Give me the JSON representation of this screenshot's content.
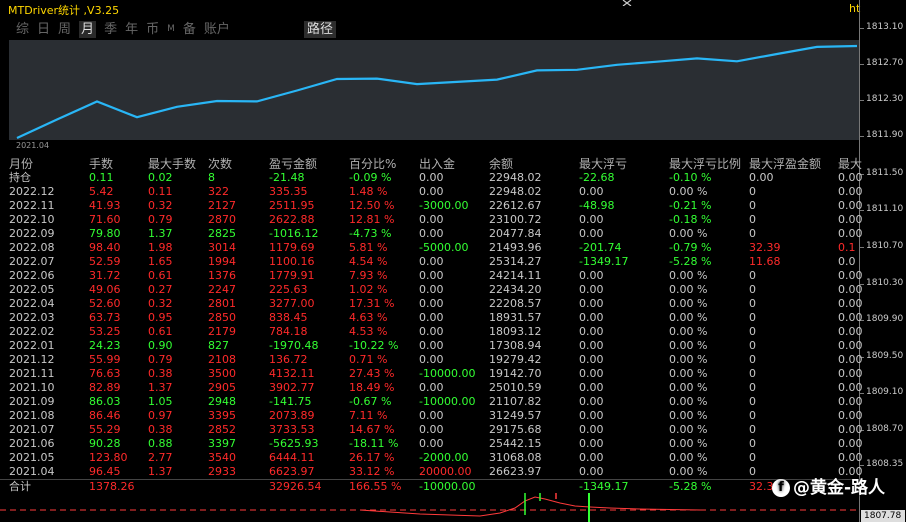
{
  "header": {
    "title": "MTDriver统计 ,V3.25",
    "title_right": "ht"
  },
  "tabs": [
    {
      "label": "综",
      "active": false
    },
    {
      "label": "日",
      "active": false
    },
    {
      "label": "周",
      "active": false
    },
    {
      "label": "月",
      "active": true
    },
    {
      "label": "季",
      "active": false
    },
    {
      "label": "年",
      "active": false
    },
    {
      "label": "币",
      "active": false
    },
    {
      "label": "M",
      "active": false
    },
    {
      "label": "备",
      "active": false
    },
    {
      "label": "账户",
      "active": false
    }
  ],
  "route_tab": "路径",
  "chart": {
    "date_label": "2021.04"
  },
  "yaxis": [
    "1813.10",
    "1812.70",
    "1812.30",
    "1811.90",
    "1811.50",
    "1811.10",
    "1810.70",
    "1810.30",
    "1809.90",
    "1809.50",
    "1809.10",
    "1808.70",
    "1808.35",
    "1807.78"
  ],
  "columns": [
    "月份",
    "手数",
    "最大手数",
    "次数",
    "盈亏金额",
    "百分比%",
    "出入金",
    "余额",
    "最大浮亏",
    "最大浮亏比例",
    "最大浮盈金额",
    "最大"
  ],
  "holding": {
    "label": "持仓",
    "lots": "0.11",
    "max_lots": "0.02",
    "count": "8",
    "pnl": "-21.48",
    "pct": "-0.09 %",
    "io": "0.00",
    "balance": "22948.02",
    "float_loss": "-22.68",
    "float_loss_pct": "-0.10 %",
    "float_profit": "0.00",
    "last": "0.00"
  },
  "rows": [
    {
      "month": "2022.12",
      "lots": "5.42",
      "max_lots": "0.11",
      "count": "322",
      "pnl": "335.35",
      "pct": "1.48 %",
      "io": "0.00",
      "balance": "22948.02",
      "float_loss": "0.00",
      "float_loss_pct": "0.00 %",
      "float_profit": "0",
      "last": "0.00",
      "color": "red"
    },
    {
      "month": "2022.11",
      "lots": "41.93",
      "max_lots": "0.32",
      "count": "2127",
      "pnl": "2511.95",
      "pct": "12.50 %",
      "io": "-3000.00",
      "balance": "22612.67",
      "float_loss": "-48.98",
      "float_loss_pct": "-0.21 %",
      "float_profit": "0",
      "last": "0.00",
      "color": "red"
    },
    {
      "month": "2022.10",
      "lots": "71.60",
      "max_lots": "0.79",
      "count": "2870",
      "pnl": "2622.88",
      "pct": "12.81 %",
      "io": "0.00",
      "balance": "23100.72",
      "float_loss": "0.00",
      "float_loss_pct": "-0.18 %",
      "float_profit": "0",
      "last": "0.00",
      "color": "red"
    },
    {
      "month": "2022.09",
      "lots": "79.80",
      "max_lots": "1.37",
      "count": "2825",
      "pnl": "-1016.12",
      "pct": "-4.73 %",
      "io": "0.00",
      "balance": "20477.84",
      "float_loss": "0.00",
      "float_loss_pct": "0.00 %",
      "float_profit": "0",
      "last": "0.00",
      "color": "green"
    },
    {
      "month": "2022.08",
      "lots": "98.40",
      "max_lots": "1.98",
      "count": "3014",
      "pnl": "1179.69",
      "pct": "5.81 %",
      "io": "-5000.00",
      "balance": "21493.96",
      "float_loss": "-201.74",
      "float_loss_pct": "-0.79 %",
      "float_profit": "32.39",
      "last": "0.1",
      "color": "red"
    },
    {
      "month": "2022.07",
      "lots": "52.59",
      "max_lots": "1.65",
      "count": "1994",
      "pnl": "1100.16",
      "pct": "4.54 %",
      "io": "0.00",
      "balance": "25314.27",
      "float_loss": "-1349.17",
      "float_loss_pct": "-5.28 %",
      "float_profit": "11.68",
      "last": "0.0",
      "color": "red"
    },
    {
      "month": "2022.06",
      "lots": "31.72",
      "max_lots": "0.61",
      "count": "1376",
      "pnl": "1779.91",
      "pct": "7.93 %",
      "io": "0.00",
      "balance": "24214.11",
      "float_loss": "0.00",
      "float_loss_pct": "0.00 %",
      "float_profit": "0",
      "last": "0.00",
      "color": "red"
    },
    {
      "month": "2022.05",
      "lots": "49.06",
      "max_lots": "0.27",
      "count": "2247",
      "pnl": "225.63",
      "pct": "1.02 %",
      "io": "0.00",
      "balance": "22434.20",
      "float_loss": "0.00",
      "float_loss_pct": "0.00 %",
      "float_profit": "0",
      "last": "0.00",
      "color": "red"
    },
    {
      "month": "2022.04",
      "lots": "52.60",
      "max_lots": "0.32",
      "count": "2801",
      "pnl": "3277.00",
      "pct": "17.31 %",
      "io": "0.00",
      "balance": "22208.57",
      "float_loss": "0.00",
      "float_loss_pct": "0.00 %",
      "float_profit": "0",
      "last": "0.00",
      "color": "red"
    },
    {
      "month": "2022.03",
      "lots": "63.73",
      "max_lots": "0.95",
      "count": "2850",
      "pnl": "838.45",
      "pct": "4.63 %",
      "io": "0.00",
      "balance": "18931.57",
      "float_loss": "0.00",
      "float_loss_pct": "0.00 %",
      "float_profit": "0",
      "last": "0.00",
      "color": "red"
    },
    {
      "month": "2022.02",
      "lots": "53.25",
      "max_lots": "0.61",
      "count": "2179",
      "pnl": "784.18",
      "pct": "4.53 %",
      "io": "0.00",
      "balance": "18093.12",
      "float_loss": "0.00",
      "float_loss_pct": "0.00 %",
      "float_profit": "0",
      "last": "0.00",
      "color": "red"
    },
    {
      "month": "2022.01",
      "lots": "24.23",
      "max_lots": "0.90",
      "count": "827",
      "pnl": "-1970.48",
      "pct": "-10.22 %",
      "io": "0.00",
      "balance": "17308.94",
      "float_loss": "0.00",
      "float_loss_pct": "0.00 %",
      "float_profit": "0",
      "last": "0.00",
      "color": "green"
    },
    {
      "month": "2021.12",
      "lots": "55.99",
      "max_lots": "0.79",
      "count": "2108",
      "pnl": "136.72",
      "pct": "0.71 %",
      "io": "0.00",
      "balance": "19279.42",
      "float_loss": "0.00",
      "float_loss_pct": "0.00 %",
      "float_profit": "0",
      "last": "0.00",
      "color": "red"
    },
    {
      "month": "2021.11",
      "lots": "76.63",
      "max_lots": "0.38",
      "count": "3500",
      "pnl": "4132.11",
      "pct": "27.43 %",
      "io": "-10000.00",
      "balance": "19142.70",
      "float_loss": "0.00",
      "float_loss_pct": "0.00 %",
      "float_profit": "0",
      "last": "0.00",
      "color": "red"
    },
    {
      "month": "2021.10",
      "lots": "82.89",
      "max_lots": "1.37",
      "count": "2905",
      "pnl": "3902.77",
      "pct": "18.49 %",
      "io": "0.00",
      "balance": "25010.59",
      "float_loss": "0.00",
      "float_loss_pct": "0.00 %",
      "float_profit": "0",
      "last": "0.00",
      "color": "red"
    },
    {
      "month": "2021.09",
      "lots": "86.03",
      "max_lots": "1.05",
      "count": "2948",
      "pnl": "-141.75",
      "pct": "-0.67 %",
      "io": "-10000.00",
      "balance": "21107.82",
      "float_loss": "0.00",
      "float_loss_pct": "0.00 %",
      "float_profit": "0",
      "last": "0.00",
      "color": "green"
    },
    {
      "month": "2021.08",
      "lots": "86.46",
      "max_lots": "0.97",
      "count": "3395",
      "pnl": "2073.89",
      "pct": "7.11 %",
      "io": "0.00",
      "balance": "31249.57",
      "float_loss": "0.00",
      "float_loss_pct": "0.00 %",
      "float_profit": "0",
      "last": "0.00",
      "color": "red"
    },
    {
      "month": "2021.07",
      "lots": "55.29",
      "max_lots": "0.38",
      "count": "2852",
      "pnl": "3733.53",
      "pct": "14.67 %",
      "io": "0.00",
      "balance": "29175.68",
      "float_loss": "0.00",
      "float_loss_pct": "0.00 %",
      "float_profit": "0",
      "last": "0.00",
      "color": "red"
    },
    {
      "month": "2021.06",
      "lots": "90.28",
      "max_lots": "0.88",
      "count": "3397",
      "pnl": "-5625.93",
      "pct": "-18.11 %",
      "io": "0.00",
      "balance": "25442.15",
      "float_loss": "0.00",
      "float_loss_pct": "0.00 %",
      "float_profit": "0",
      "last": "0.00",
      "color": "green"
    },
    {
      "month": "2021.05",
      "lots": "123.80",
      "max_lots": "2.77",
      "count": "3540",
      "pnl": "6444.11",
      "pct": "26.17 %",
      "io": "-2000.00",
      "balance": "31068.08",
      "float_loss": "0.00",
      "float_loss_pct": "0.00 %",
      "float_profit": "0",
      "last": "0.00",
      "color": "red"
    },
    {
      "month": "2021.04",
      "lots": "96.45",
      "max_lots": "1.37",
      "count": "2933",
      "pnl": "6623.97",
      "pct": "33.12 %",
      "io": "20000.00",
      "balance": "26623.97",
      "float_loss": "0.00",
      "float_loss_pct": "0.00 %",
      "float_profit": "0",
      "last": "0.00",
      "color": "red"
    }
  ],
  "total": {
    "label": "合计",
    "lots": "1378.26",
    "pnl": "32926.54",
    "pct": "166.55 %",
    "io": "-10000.00",
    "float_loss": "-1349.17",
    "float_loss_pct": "-5.28 %",
    "float_profit": "32.39"
  },
  "watermark": {
    "icon_letter": "f",
    "text": "@黄金-路人"
  },
  "price_box": "1807.78",
  "colors": {
    "red": "#ff2a2a",
    "green": "#33ff33",
    "line": "#29b6f6",
    "chart_bg": "#2a2e33"
  }
}
